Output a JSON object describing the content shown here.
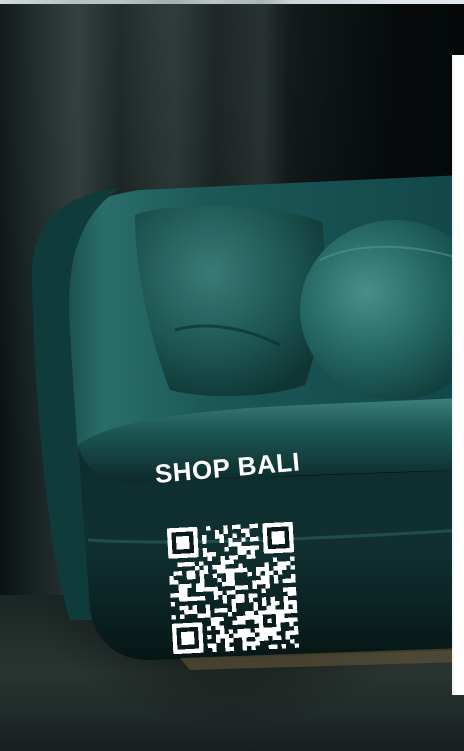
{
  "scene": {
    "description_colors": {
      "velvet": "#1c5f5c",
      "velvet_dark": "#0e3433",
      "velvet_highlight": "#4a8a86",
      "background": "#081012"
    }
  },
  "overlay": {
    "label": "SHOP BALI"
  },
  "qr": {
    "icon": "qr-code-icon"
  }
}
